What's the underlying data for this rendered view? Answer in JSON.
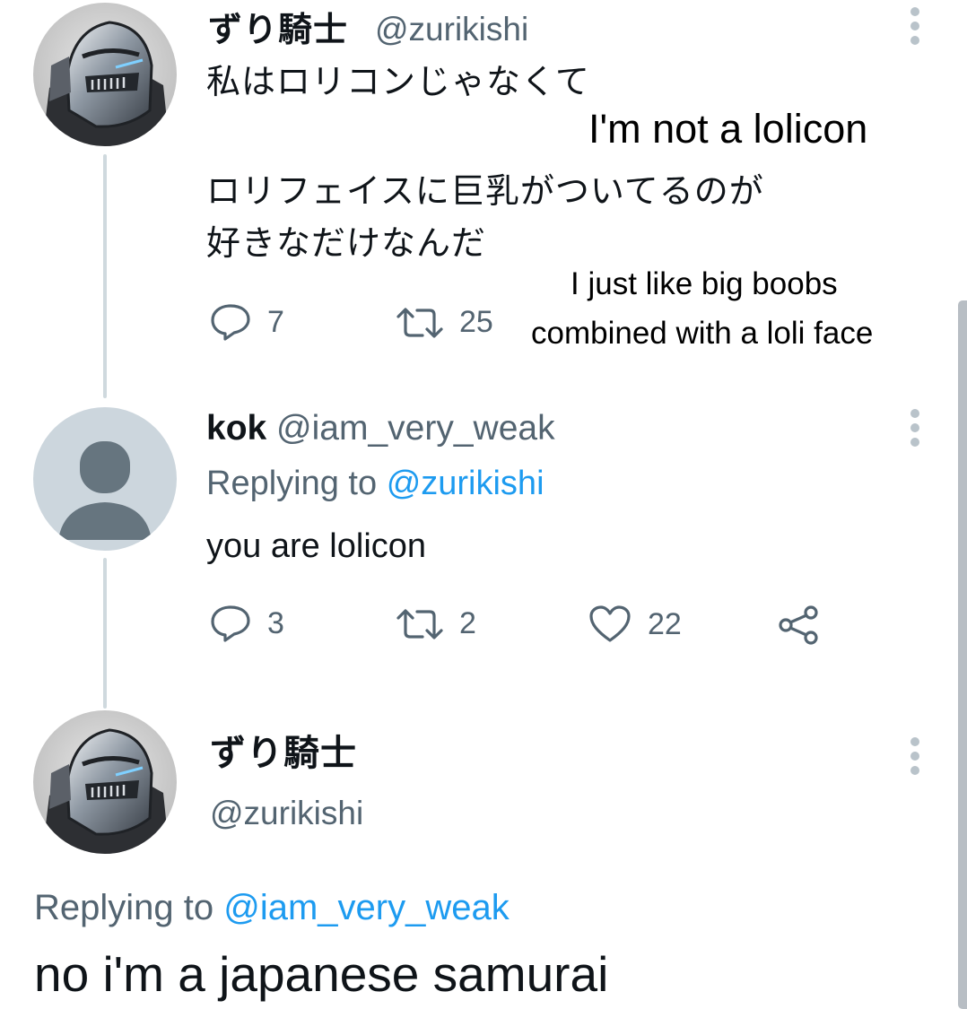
{
  "tweet1": {
    "display_name": "ずり騎士",
    "handle": "@zurikishi",
    "text_line1": "私はロリコンじゃなくて",
    "text_line2": "ロリフェイスに巨乳がついてるのが",
    "text_line3": "好きなだけなんだ",
    "overlay_translation_1": "I'm not a lolicon",
    "overlay_translation_2a": "I just like big boobs",
    "overlay_translation_2b": "combined with a loli face",
    "reply_count": "7",
    "retweet_count": "25",
    "avatar_icon": "knight-helmet-avatar"
  },
  "tweet2": {
    "display_name": "kok",
    "handle": "@iam_very_weak",
    "replying_prefix": "Replying to",
    "replying_to": "@zurikishi",
    "text": "you are lolicon",
    "reply_count": "3",
    "retweet_count": "2",
    "like_count": "22",
    "avatar_icon": "default-profile-avatar"
  },
  "tweet3": {
    "display_name": "ずり騎士",
    "handle": "@zurikishi",
    "replying_prefix": "Replying to",
    "replying_to": "@iam_very_weak",
    "text": "no i'm a japanese samurai",
    "avatar_icon": "knight-helmet-avatar"
  },
  "colors": {
    "accent": "#1d9bf0",
    "secondary_text": "#536471",
    "thread_line": "#cfd9de"
  }
}
